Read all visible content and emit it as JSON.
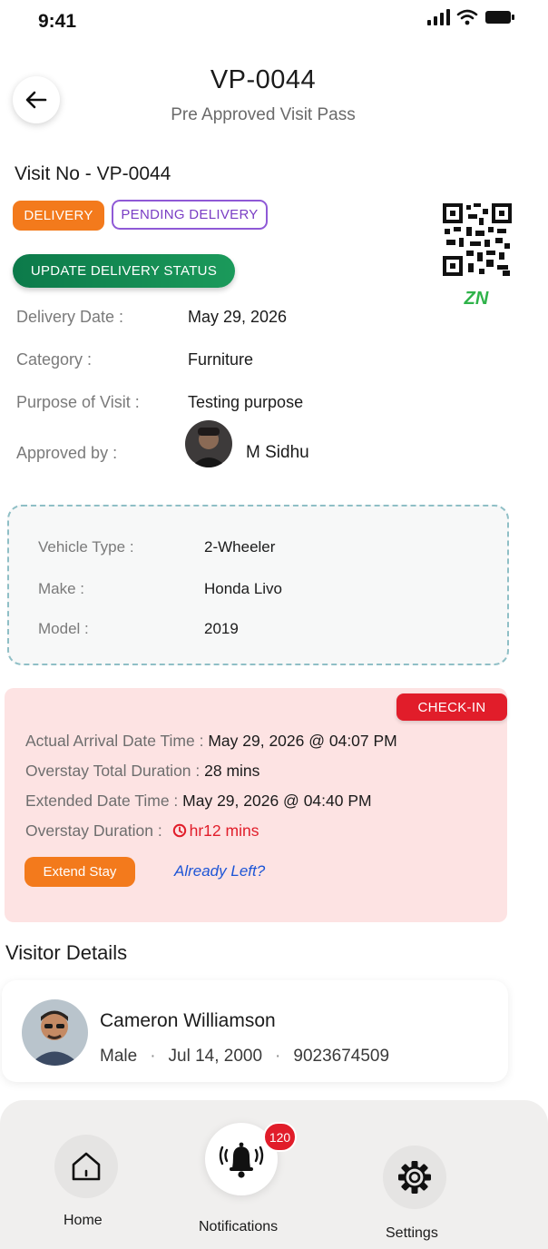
{
  "status_bar": {
    "time": "9:41"
  },
  "header": {
    "title": "VP-0044",
    "subtitle": "Pre Approved Visit Pass"
  },
  "visit": {
    "visit_no": "Visit No - VP-0044",
    "badges": {
      "type": "DELIVERY",
      "status": "PENDING DELIVERY"
    },
    "update_button": "UPDATE DELIVERY STATUS",
    "zone": "ZN",
    "fields": {
      "delivery_date": {
        "label": "Delivery Date :",
        "value": "May 29, 2026"
      },
      "category": {
        "label": "Category :",
        "value": "Furniture"
      },
      "purpose": {
        "label": "Purpose of Visit :",
        "value": "Testing purpose"
      },
      "approved_by": {
        "label": "Approved by :",
        "value": "M Sidhu"
      }
    }
  },
  "vehicle": {
    "type": {
      "label": "Vehicle Type :",
      "value": "2-Wheeler"
    },
    "make": {
      "label": "Make :",
      "value": "Honda Livo"
    },
    "model": {
      "label": "Model :",
      "value": "2019"
    }
  },
  "checkin": {
    "badge": "CHECK-IN",
    "arrival": {
      "label": "Actual Arrival Date Time : ",
      "value": "May 29, 2026 @ 04:07 PM"
    },
    "overstay_total": {
      "label": "Overstay Total Duration : ",
      "value": "28 mins"
    },
    "extended": {
      "label": "Extended Date Time : ",
      "value": "May 29, 2026 @ 04:40 PM"
    },
    "overstay_duration": {
      "label": "Overstay Duration : ",
      "value": "hr12 mins"
    },
    "extend_button": "Extend Stay",
    "left_link": "Already Left?"
  },
  "visitor": {
    "heading": "Visitor Details",
    "name": "Cameron Williamson",
    "gender": "Male",
    "dob": "Jul 14, 2000",
    "phone": "9023674509"
  },
  "nav": {
    "home": "Home",
    "notifications": "Notifications",
    "notification_count": "120",
    "settings": "Settings"
  },
  "colors": {
    "orange": "#f37a1c",
    "purple": "#7a3ec4",
    "green": "#1b9a5b",
    "red": "#e11d2a",
    "link_blue": "#1d55d6",
    "zone_green": "#2fb34a"
  }
}
